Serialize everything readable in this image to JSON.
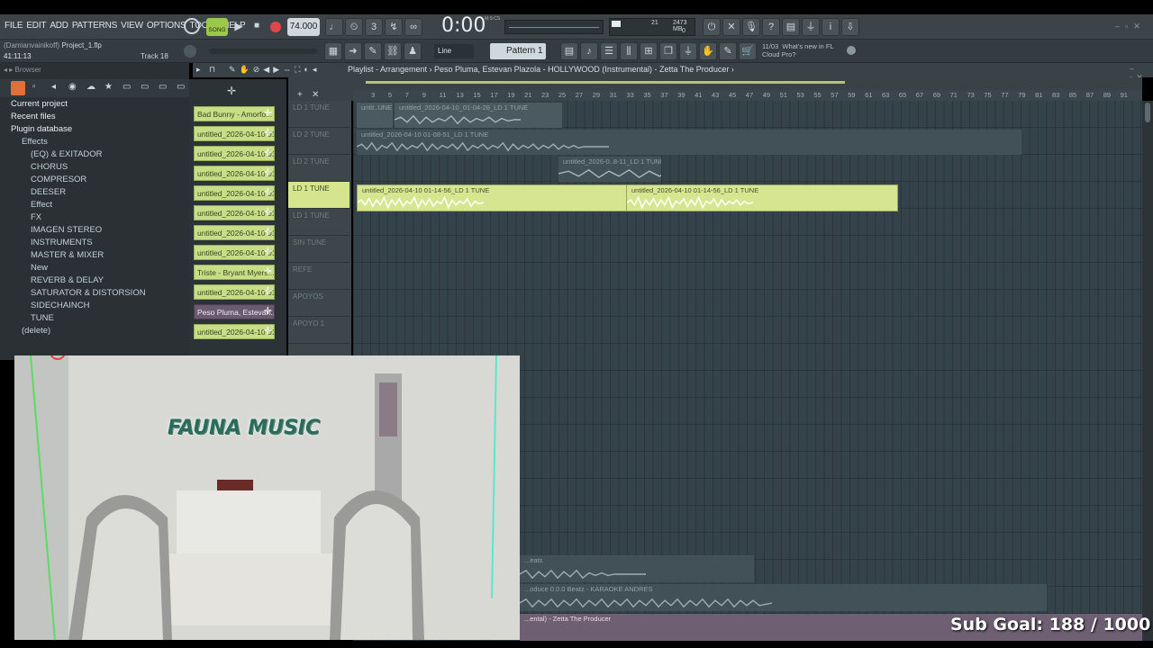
{
  "menu": [
    "FILE",
    "EDIT",
    "ADD",
    "PATTERNS",
    "VIEW",
    "OPTIONS",
    "TOOLS",
    "HELP"
  ],
  "transport": {
    "song_label": "SONG",
    "tempo": "74.000",
    "time": "0:00",
    "time_unit": "M:S:CS"
  },
  "system": {
    "cpu_val": "21",
    "ram": "2473 MB",
    "ram_sub": "0"
  },
  "pattern_label": "Pattern 1",
  "snap_label": "Line",
  "news": {
    "date": "11/03",
    "text": "What's new in FL",
    "text2": "Cloud Pro?"
  },
  "project": {
    "user": "(Damianvainikoff)",
    "file": "Project_1.flp",
    "time": "41:11:13",
    "track": "Track 18"
  },
  "browser": {
    "title": "Browser",
    "items": [
      {
        "label": "Current project",
        "level": 0
      },
      {
        "label": "Recent files",
        "level": 0
      },
      {
        "label": "Plugin database",
        "level": 0
      },
      {
        "label": "Effects",
        "level": 1
      },
      {
        "label": "(EQ) & EXITADOR",
        "level": 2
      },
      {
        "label": "CHORUS",
        "level": 2
      },
      {
        "label": "COMPRESOR",
        "level": 2
      },
      {
        "label": "DEESER",
        "level": 2
      },
      {
        "label": "Effect",
        "level": 2
      },
      {
        "label": "FX",
        "level": 2
      },
      {
        "label": "IMAGEN STEREO",
        "level": 2
      },
      {
        "label": "INSTRUMENTS",
        "level": 2
      },
      {
        "label": "MASTER & MIXER",
        "level": 2
      },
      {
        "label": "New",
        "level": 2
      },
      {
        "label": "REVERB & DELAY",
        "level": 2
      },
      {
        "label": "SATURATOR & DISTORSION",
        "level": 2
      },
      {
        "label": "SIDECHAINCH",
        "level": 2
      },
      {
        "label": "TUNE",
        "level": 2
      },
      {
        "label": "(delete)",
        "level": 1
      }
    ]
  },
  "channels": [
    {
      "label": "Bad Bunny - Amorfo...",
      "dark": false
    },
    {
      "label": "untitled_2026-04-10 01-...",
      "dark": false
    },
    {
      "label": "untitled_2026-04-10 01-...",
      "dark": false
    },
    {
      "label": "untitled_2026-04-10 01-...",
      "dark": false
    },
    {
      "label": "untitled_2026-04-10 01-...",
      "dark": false
    },
    {
      "label": "untitled_2026-04-10 01-...",
      "dark": false
    },
    {
      "label": "untitled_2026-04-10 01-...",
      "dark": false
    },
    {
      "label": "untitled_2026-04-10 01-...",
      "dark": false
    },
    {
      "label": "Triste - Bryant Myers...",
      "dark": false
    },
    {
      "label": "untitled_2026-04-10 01-...",
      "dark": false
    },
    {
      "label": "Peso Pluma, Estevan...",
      "dark": true
    },
    {
      "label": "untitled_2026-04-10 01-...",
      "dark": false
    }
  ],
  "playlist": {
    "breadcrumb": "Playlist - Arrangement › Peso Pluma, Estevan Plazola - HOLLYWOOD (Instrumental) - Zetta The Producer ›",
    "ruler": [
      "3",
      "5",
      "7",
      "9",
      "11",
      "13",
      "15",
      "17",
      "19",
      "21",
      "23",
      "25",
      "27",
      "29",
      "31",
      "33",
      "35",
      "37",
      "39",
      "41",
      "43",
      "45",
      "47",
      "49",
      "51",
      "53",
      "55",
      "57",
      "59",
      "61",
      "63",
      "65",
      "67",
      "69",
      "71",
      "73",
      "75",
      "77",
      "79",
      "81",
      "83",
      "85",
      "87",
      "89",
      "91"
    ],
    "tracks": [
      {
        "label": "LD 1 TUNE",
        "active": false
      },
      {
        "label": "LD 2 TUNE",
        "active": false
      },
      {
        "label": "LD 2 TUNE",
        "active": false
      },
      {
        "label": "LD 1 TUNE",
        "active": true
      },
      {
        "label": "LD 1 TUNE",
        "active": false
      },
      {
        "label": "SIN TUNE",
        "active": false
      },
      {
        "label": "REFE",
        "active": false
      },
      {
        "label": "APOYOS",
        "active": false
      },
      {
        "label": "APOYO 1",
        "active": false
      }
    ],
    "clips": {
      "c1": "untit..UNE",
      "c2": "untitled_2026-04-10_01-04-28_LD 1 TUNE",
      "c3": "untitled_2026-04-10 01-08-51_LD 1 TUNE",
      "c4": "untitled_2026-0..8-11_LD 1 TUNE",
      "c5": "untitled_2026-04-10 01-14-56_LD 1 TUNE",
      "c6": "untitled_2026-04-10 01-14-56_LD 1 TUNE",
      "b1": "...eats",
      "b2": "...oduce 0.0.0 Beatz - KARAOKE ANDRES",
      "b3": "...ental) - Zetta The Producer"
    }
  },
  "stream": {
    "overlay_title": "FAUNA MUSIC",
    "sub_goal": "Sub Goal:  188 / 1000"
  }
}
